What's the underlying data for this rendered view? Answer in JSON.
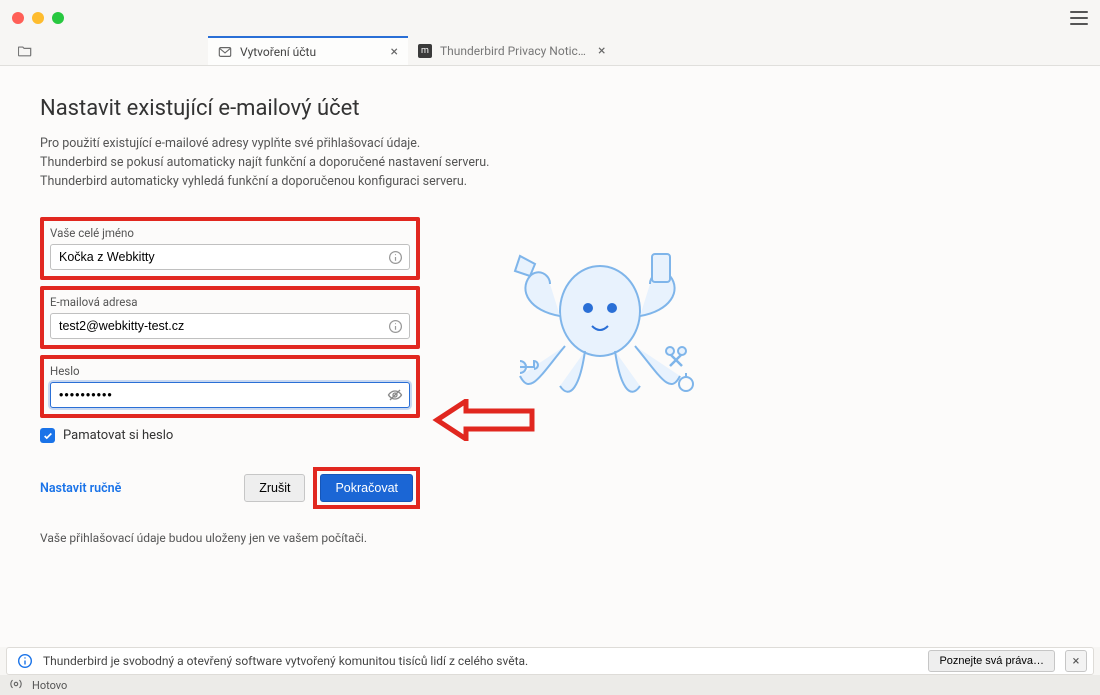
{
  "tabs": {
    "active": {
      "label": "Vytvoření účtu"
    },
    "second": {
      "label": "Thunderbird Privacy Notice — Mozil"
    }
  },
  "page": {
    "title": "Nastavit existující e-mailový účet",
    "desc_line1": "Pro použití existující e-mailové adresy vyplňte své přihlašovací údaje.",
    "desc_line2": "Thunderbird se pokusí automaticky najít funkční a doporučené nastavení serveru.",
    "desc_line3": "Thunderbird automaticky vyhledá funkční a doporučenou konfiguraci serveru."
  },
  "form": {
    "name": {
      "label": "Vaše celé jméno",
      "value": "Kočka z Webkitty"
    },
    "email": {
      "label": "E-mailová adresa",
      "value": "test2@webkitty-test.cz"
    },
    "password": {
      "label": "Heslo",
      "value": "••••••••••"
    },
    "remember_label": "Pamatovat si heslo"
  },
  "actions": {
    "manual": "Nastavit ručně",
    "cancel": "Zrušit",
    "continue": "Pokračovat"
  },
  "footer_note": "Vaše přihlašovací údaje budou uloženy jen ve vašem počítači.",
  "notification": {
    "text": "Thunderbird je svobodný a otevřený software vytvořený komunitou tisíců lidí z celého světa.",
    "button": "Poznejte svá práva…"
  },
  "status": {
    "text": "Hotovo"
  }
}
